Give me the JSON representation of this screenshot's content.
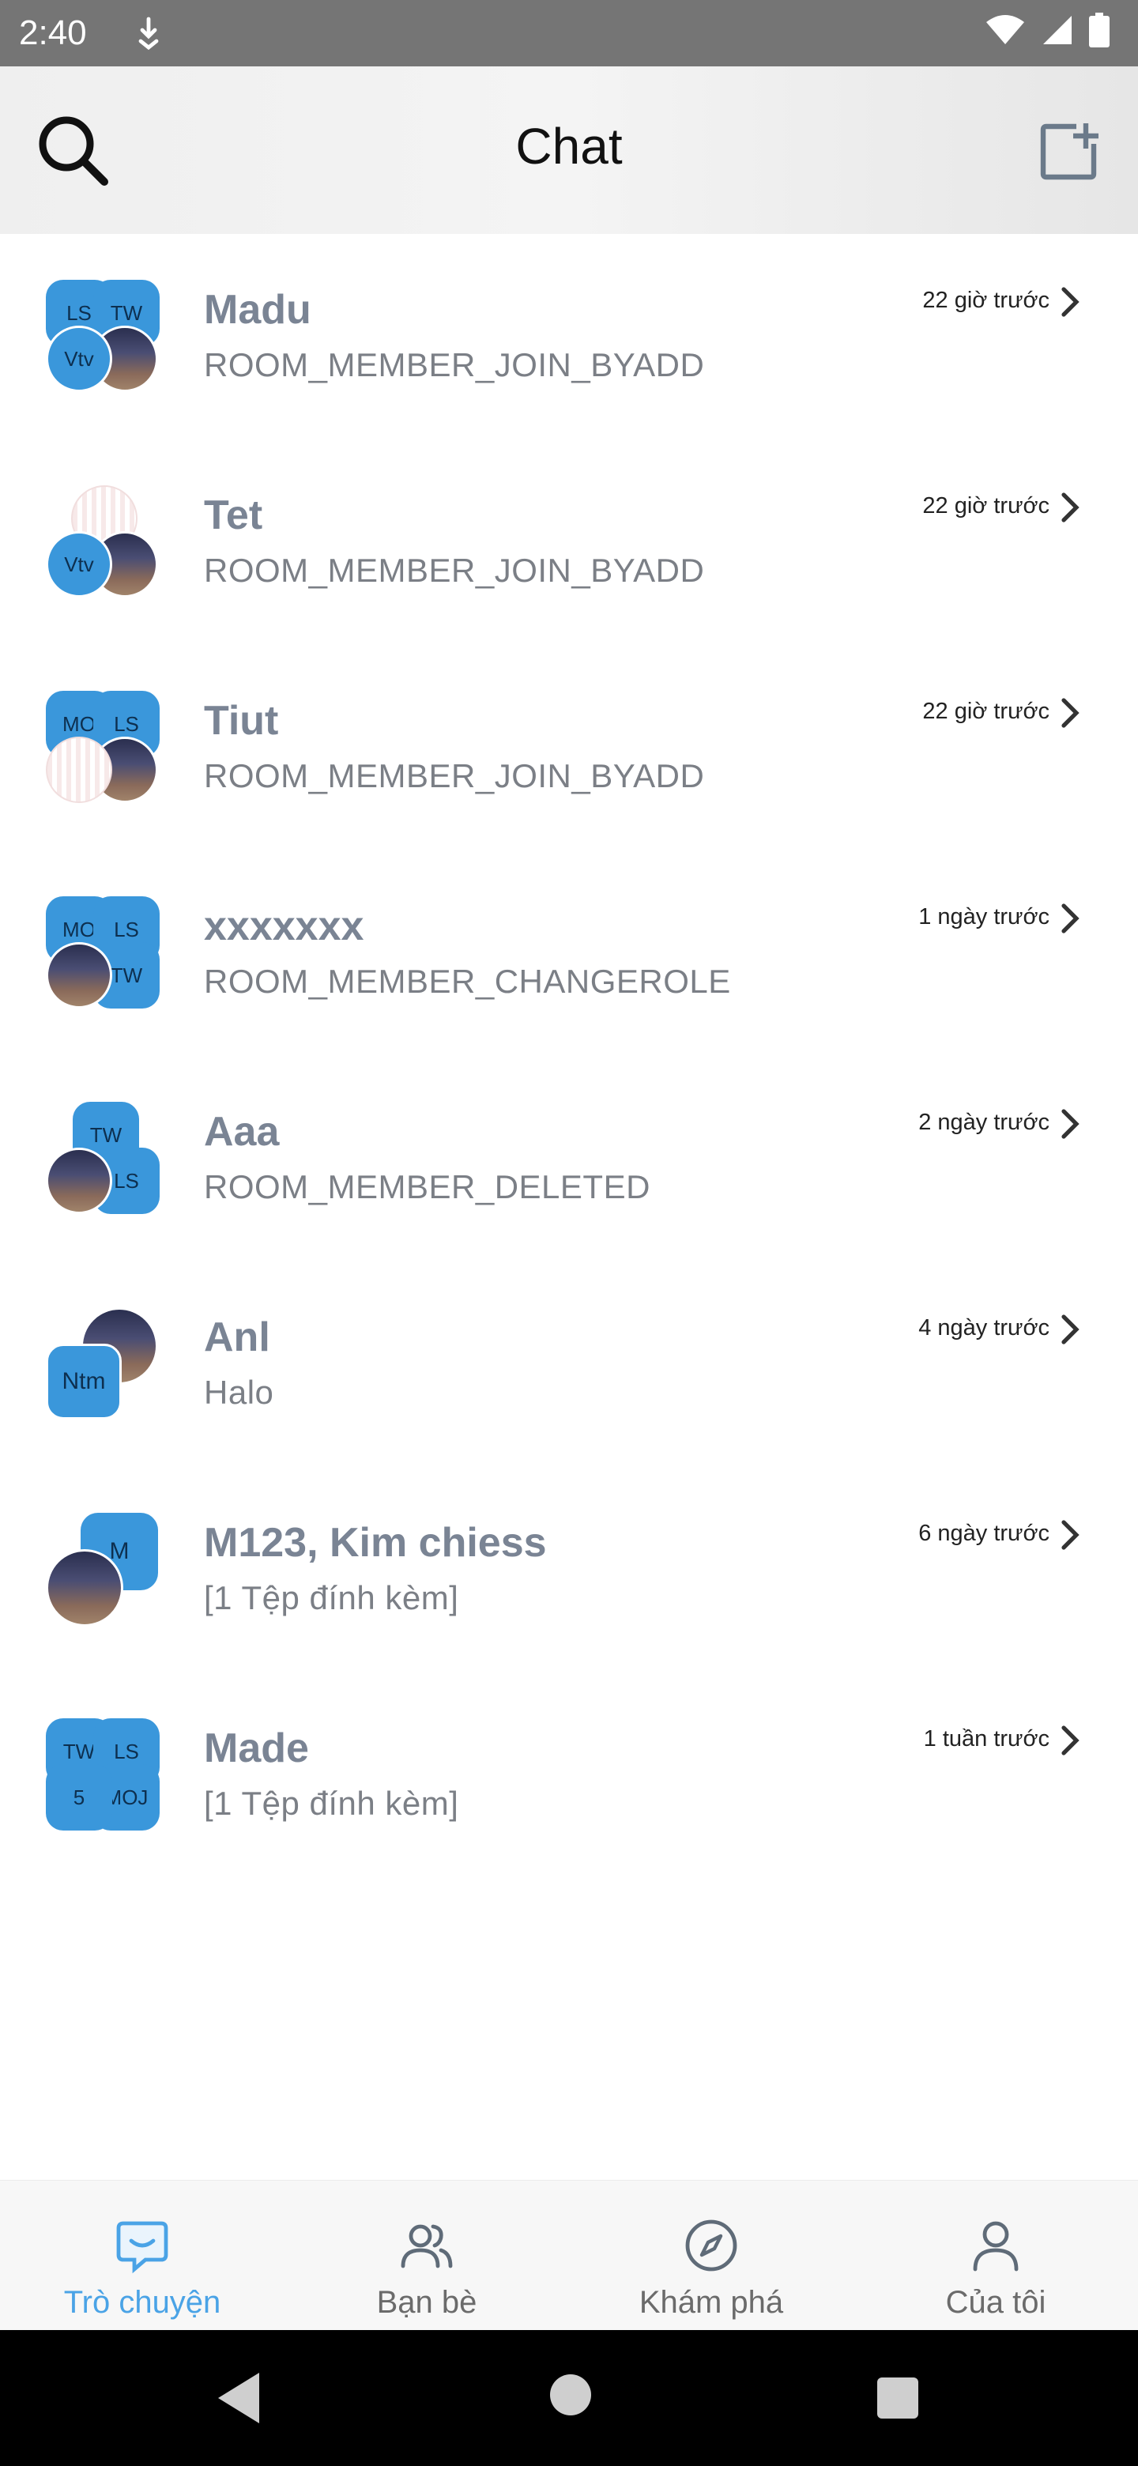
{
  "status_bar": {
    "time": "2:40"
  },
  "app_bar": {
    "title": "Chat",
    "search_icon": "search-icon",
    "compose_icon": "add-chat-icon"
  },
  "chats": [
    {
      "name": "Madu",
      "message": "ROOM_MEMBER_JOIN_BYADD",
      "time": "22 giờ trước",
      "avatars": [
        "LS",
        "TW",
        "Vtv",
        "photo"
      ]
    },
    {
      "name": "Tet",
      "message": "ROOM_MEMBER_JOIN_BYADD",
      "time": "22 giờ trước",
      "avatars": [
        "striped",
        "Vtv",
        "photo"
      ]
    },
    {
      "name": "Tiut",
      "message": "ROOM_MEMBER_JOIN_BYADD",
      "time": "22 giờ trước",
      "avatars": [
        "MO",
        "LS",
        "striped",
        "photo"
      ]
    },
    {
      "name": "xxxxxxx",
      "message": "ROOM_MEMBER_CHANGEROLE",
      "time": "1 ngày trước",
      "avatars": [
        "MO",
        "LS",
        "TW",
        "photo"
      ]
    },
    {
      "name": "Aaa",
      "message": "ROOM_MEMBER_DELETED",
      "time": "2 ngày trước",
      "avatars": [
        "TW",
        "LS",
        "photo"
      ]
    },
    {
      "name": "Anl",
      "message": "Halo",
      "time": "4 ngày trước",
      "avatars": [
        "photo",
        "Ntm"
      ]
    },
    {
      "name": "M123, Kim chiess",
      "message": "[1 Tệp đính kèm]",
      "time": "6 ngày trước",
      "avatars": [
        "M",
        "photo"
      ]
    },
    {
      "name": "Made",
      "message": "[1 Tệp đính kèm]",
      "time": "1 tuần trước",
      "avatars": [
        "TW",
        "LS",
        "5",
        "MOJ"
      ]
    }
  ],
  "bottom_nav": {
    "items": [
      {
        "label": "Trò chuyện",
        "icon": "chat-bubble-icon",
        "active": true
      },
      {
        "label": "Bạn bè",
        "icon": "friends-icon",
        "active": false
      },
      {
        "label": "Khám phá",
        "icon": "compass-icon",
        "active": false
      },
      {
        "label": "Của tôi",
        "icon": "user-icon",
        "active": false
      }
    ]
  },
  "colors": {
    "accent": "#4aa3e6",
    "avatar_blue": "#3a97db",
    "name_gray": "#7a8494"
  }
}
